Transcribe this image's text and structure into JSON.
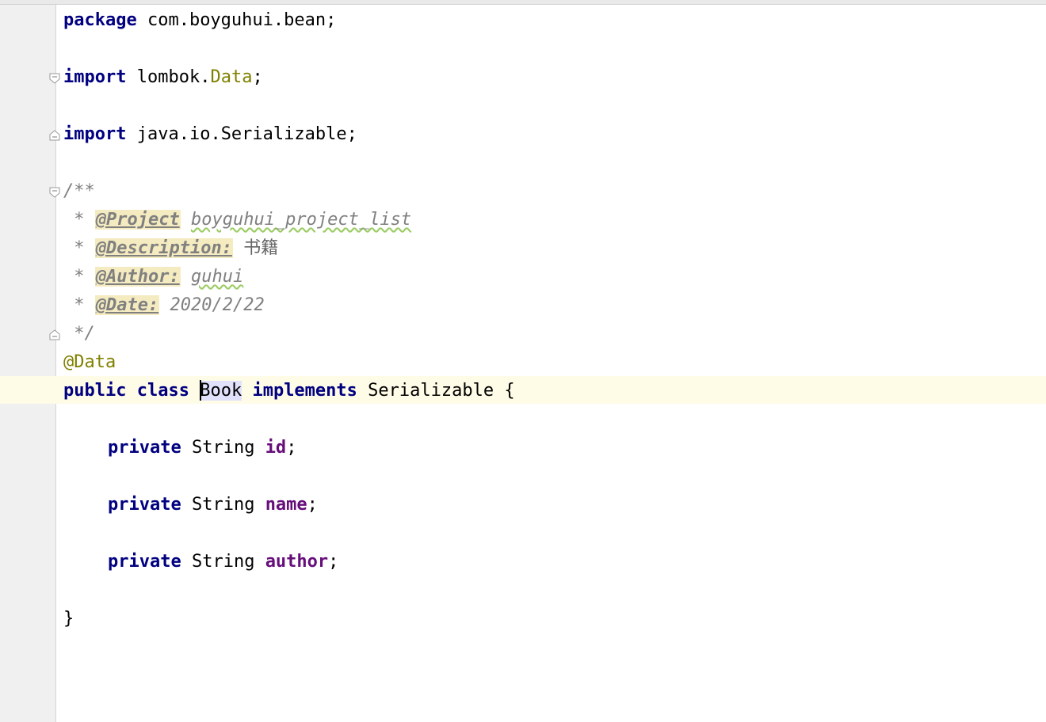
{
  "editor": {
    "language": "java",
    "lines": {
      "l1": {
        "kw": "package",
        "rest": " com.boyguhui.bean;"
      },
      "l3": {
        "kw": "import",
        "pkg": " lombok.",
        "cls": "Data",
        "end": ";"
      },
      "l5": {
        "kw": "import",
        "rest": " java.io.Serializable;"
      },
      "l7": {
        "text": "/**"
      },
      "l8": {
        "star": " * ",
        "tag": "@Project",
        "val": "boyguhui_project_list"
      },
      "l9": {
        "star": " * ",
        "tag": "@Description:",
        "val": "书籍"
      },
      "l10": {
        "star": " * ",
        "tag": "@Author:",
        "val": "guhui"
      },
      "l11": {
        "star": " * ",
        "tag": "@Date:",
        "val": "2020/2/22"
      },
      "l12": {
        "text": " */"
      },
      "l13": {
        "ann": "@Data"
      },
      "l14": {
        "kw1": "public",
        "kw2": "class",
        "name": "Book",
        "kw3": "implements",
        "iface": "Serializable {"
      },
      "l16": {
        "kw": "private",
        "type": " String ",
        "field": "id",
        "end": ";"
      },
      "l18": {
        "kw": "private",
        "type": " String ",
        "field": "name",
        "end": ";"
      },
      "l20": {
        "kw": "private",
        "type": " String ",
        "field": "author",
        "end": ";"
      },
      "l22": {
        "text": "}"
      }
    }
  },
  "colors": {
    "keyword": "#000080",
    "annotation": "#808000",
    "field": "#660e7a",
    "comment": "#808080",
    "current_line": "#fefbe6",
    "gutter": "#f0f0f0"
  }
}
